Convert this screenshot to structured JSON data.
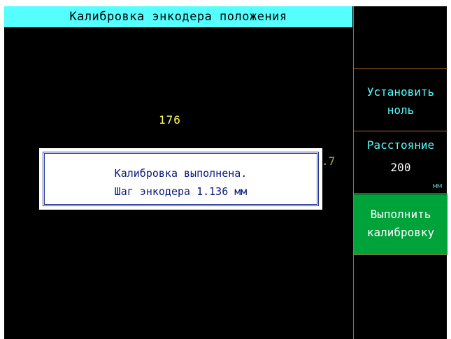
{
  "header": {
    "title": "Калибровка энкодера положения"
  },
  "main": {
    "position_value": "176",
    "partial_value": ".7"
  },
  "sidebar": {
    "set_zero": {
      "line1": "Установить",
      "line2": "ноль"
    },
    "distance": {
      "label": "Расстояние",
      "value": "200",
      "unit": "мм"
    },
    "calibrate": {
      "line1": "Выполнить",
      "line2": "калибровку"
    }
  },
  "dialog": {
    "line1": "Калибровка выполнена.",
    "line2": "Шаг энкодера 1.136 мм"
  },
  "colors": {
    "title_bg": "#55ffff",
    "screen_bg": "#000000",
    "value_text": "#ffff55",
    "softkey_text": "#55ffff",
    "active_softkey_bg": "#00a23a",
    "divider": "#b36b2a",
    "dialog_text": "#0a1a7a"
  }
}
